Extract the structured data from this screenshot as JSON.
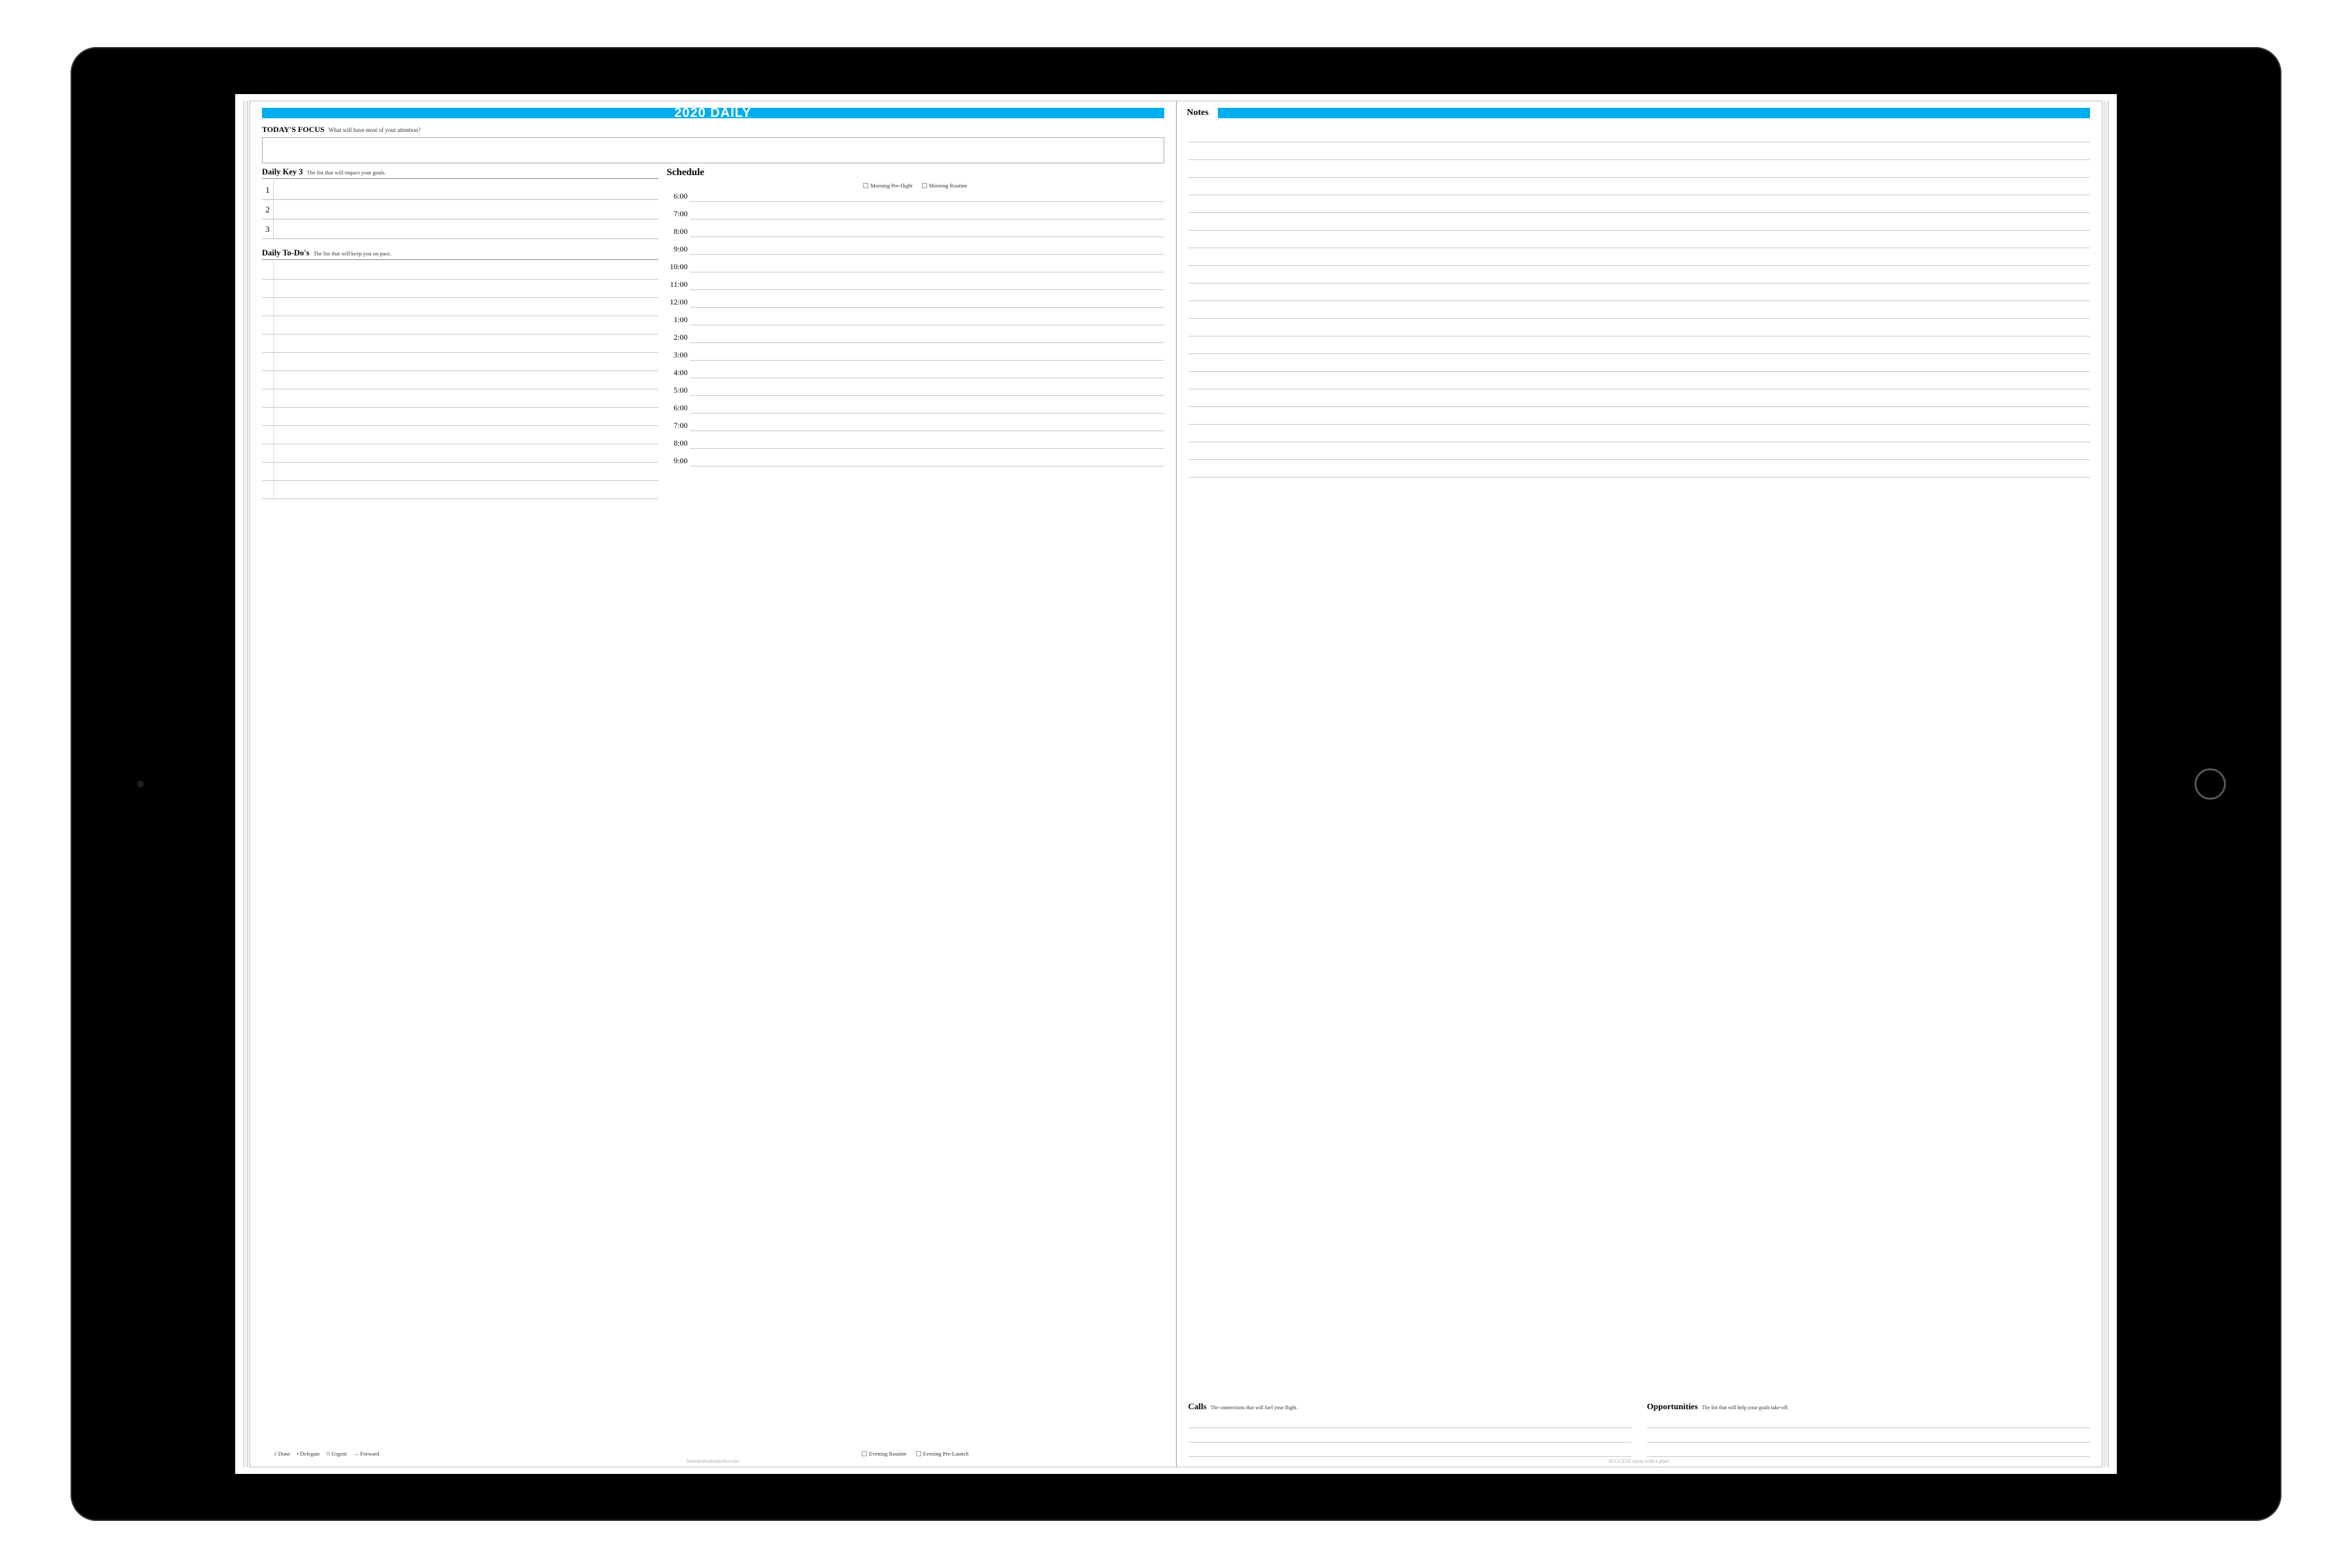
{
  "header": {
    "title": "2020 DAILY"
  },
  "focus": {
    "lead": "TODAY'S FOCUS",
    "sub": "What will have most of your attention?"
  },
  "key3": {
    "title": "Daily Key 3",
    "sub": "The list that will impact your goals.",
    "rows": [
      "1",
      "2",
      "3"
    ]
  },
  "todos": {
    "title": "Daily To-Do's",
    "sub": "The list that will keep you on pace.",
    "row_count": 13,
    "legend": {
      "done": "√ Done",
      "delegate": "• Delegate",
      "urgent": "!! Urgent",
      "forward": "→ Forward"
    }
  },
  "schedule": {
    "title": "Schedule",
    "morning_chk1": "Morning Pre-flight",
    "morning_chk2": "Morning Routine",
    "times": [
      "6:00",
      "7:00",
      "8:00",
      "9:00",
      "10:00",
      "11:00",
      "12:00",
      "1:00",
      "2:00",
      "3:00",
      "4:00",
      "5:00",
      "6:00",
      "7:00",
      "8:00",
      "9:00"
    ],
    "evening_chk1": "Evening Routine",
    "evening_chk2": "Evening Pre-Launch"
  },
  "notes": {
    "title": "Notes",
    "line_count": 20
  },
  "calls": {
    "title": "Calls",
    "sub": "The connections that will fuel your flight.",
    "line_count": 3
  },
  "opps": {
    "title": "Opportunities",
    "sub": "The list that will help your goals take-off.",
    "line_count": 3
  },
  "footer_left": "brandenbodendorfer.com",
  "footer_right": "SUCCESS starts with a plan!"
}
